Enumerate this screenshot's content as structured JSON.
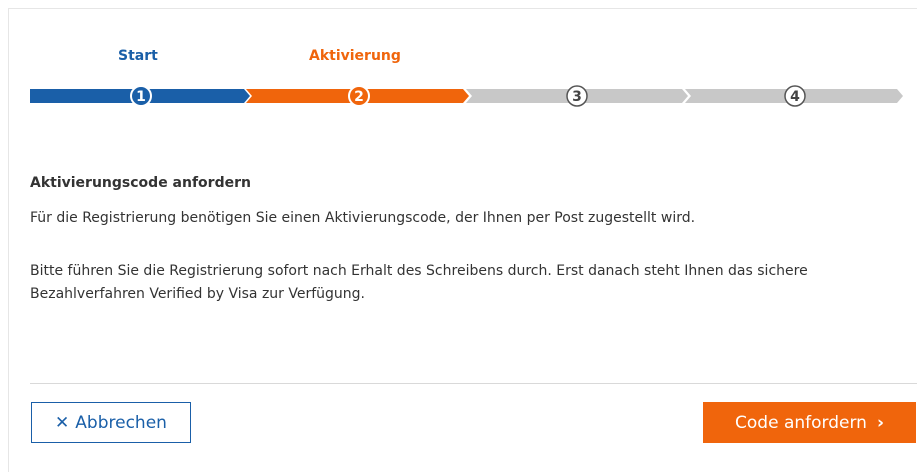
{
  "wizard": {
    "steps": [
      {
        "label": "Start",
        "number": "1",
        "color": "#1a5fa8",
        "state": "completed"
      },
      {
        "label": "Aktivierung",
        "number": "2",
        "color": "#f0650c",
        "state": "active"
      },
      {
        "label": "",
        "number": "3",
        "color": "#c8c8c8",
        "state": "pending"
      },
      {
        "label": "",
        "number": "4",
        "color": "#c8c8c8",
        "state": "pending"
      }
    ]
  },
  "content": {
    "heading": "Aktivierungscode anfordern",
    "paragraph1": "Für die Registrierung benötigen Sie einen Aktivierungscode, der Ihnen per Post zugestellt wird.",
    "paragraph2": "Bitte führen Sie die Registrierung sofort nach Erhalt des Schreibens durch. Erst danach steht Ihnen das sichere Bezahlverfahren Verified by Visa zur Verfügung."
  },
  "actions": {
    "cancel_label": "Abbrechen",
    "cancel_icon": "close-icon",
    "submit_label": "Code anfordern",
    "submit_icon": "chevron-right-icon"
  },
  "colors": {
    "primary_blue": "#1a5fa8",
    "accent_orange": "#f0650c",
    "inactive_gray": "#c8c8c8",
    "text": "#333333"
  }
}
